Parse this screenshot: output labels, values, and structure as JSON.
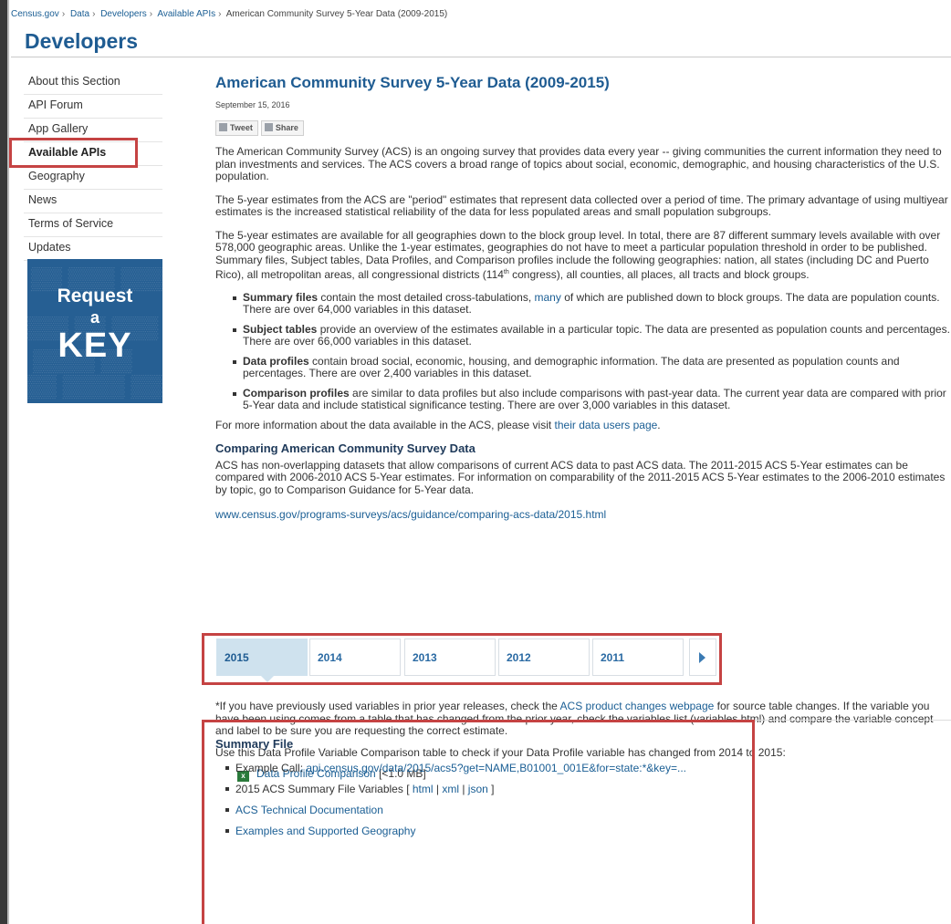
{
  "breadcrumb": [
    "Census.gov",
    "Data",
    "Developers",
    "Available APIs",
    "American Community Survey 5-Year Data (2009-2015)"
  ],
  "site_title": "Developers",
  "sidebar": {
    "items": [
      {
        "label": "About this Section"
      },
      {
        "label": "API Forum"
      },
      {
        "label": "App Gallery"
      },
      {
        "label": "Available APIs"
      },
      {
        "label": "Geography"
      },
      {
        "label": "News"
      },
      {
        "label": "Terms of Service"
      },
      {
        "label": "Updates"
      }
    ],
    "active_index": 3,
    "key_banner": {
      "line1": "Request",
      "line2": "a",
      "line3": "KEY"
    }
  },
  "main": {
    "title": "American Community Survey 5-Year Data (2009-2015)",
    "date": "September 15, 2016",
    "tweet_label": "Tweet",
    "share_label": "Share",
    "para1": "The American Community Survey (ACS) is an ongoing survey that provides data every year -- giving communities the current information they need to plan investments and services. The ACS covers a broad range of topics about social, economic, demographic, and housing characteristics of the U.S. population.",
    "para2": "The 5-year estimates from the ACS are \"period\" estimates that represent data collected over a period of time. The primary advantage of using multiyear estimates is the increased statistical reliability of the data for less populated areas and small population subgroups.",
    "para3_pre": "The 5-year estimates are available for all geographies down to the block group level.  In total, there are 87 different summary levels available with over 578,000 geographic areas.  Unlike the 1-year estimates, geographies do not have to meet a particular population threshold in order to be published.  Summary files, Subject tables, Data Profiles, and Comparison profiles include the following geographies: nation, all states (including DC and Puerto Rico), all metropolitan areas, all congressional districts (114",
    "para3_sup": "th",
    "para3_post": " congress), all counties, all places, all tracts and block groups.",
    "bullets": [
      {
        "bold": "Summary files",
        "pre": " contain the most detailed cross-tabulations, ",
        "link": "many",
        "post": " of which are published down to block groups. The data are population counts. There are over 64,000 variables in this dataset."
      },
      {
        "bold": "Subject tables",
        "pre": " provide an overview of the estimates available in a particular topic.  The data are presented as population counts and percentages.  There are over 66,000 variables in this dataset.",
        "link": "",
        "post": ""
      },
      {
        "bold": "Data profiles",
        "pre": " contain broad social, economic, housing, and demographic information. The data are presented as population counts and percentages. There are over 2,400 variables in this dataset.",
        "link": "",
        "post": ""
      },
      {
        "bold": "Comparison profiles",
        "pre": " are similar to data profiles but also include comparisons with past-year data.  The current year data are compared with prior 5-Year data and include statistical significance testing.  There are over 3,000 variables in this dataset.",
        "link": "",
        "post": ""
      }
    ],
    "more_pre": "For more information about the data available in the ACS, please visit ",
    "more_link": "their data users page",
    "more_post": ".",
    "compare_heading": "Comparing American Community Survey Data",
    "compare_para": "ACS has non-overlapping datasets that allow comparisons of current ACS data to past ACS data.  The 2011-2015 ACS 5-Year estimates can be compared with 2006-2010 ACS 5-Year estimates.  For information on comparability of the 2011-2015 ACS 5-Year estimates to the 2006-2010 estimates by topic, go to Comparison Guidance for 5-Year data.",
    "compare_url": "www.census.gov/programs-surveys/acs/guidance/comparing-acs-data/2015.html"
  },
  "year_tabs": {
    "years": [
      "2015",
      "2014",
      "2013",
      "2012",
      "2011"
    ],
    "selected": "2015"
  },
  "lower": {
    "para5_pre": "*If you have previously used variables in prior year releases, check the ",
    "para5_link": "ACS product changes webpage",
    "para5_post": " for source table changes. If the variable you have been using comes from a table that has changed from the prior year, check the variables list (variables.html) and compare the variable concept and label to be sure you are requesting the correct estimate.",
    "para6": "Use this Data Profile Variable Comparison table to check if your Data Profile variable has changed from 2014 to 2015:",
    "xls_icon": "x",
    "xls_link": "Data Profile Comparison",
    "xls_size": " [<1.0 MB]"
  },
  "summary_file": {
    "title": "Summary File",
    "example_label": "Example Call: ",
    "example_link": "api.census.gov/data/2015/acs5?get=NAME,B01001_001E&for=state:*&key=...",
    "vars_label": "2015 ACS Summary File Variables [ ",
    "vars_html": "html",
    "vars_sep1": " | ",
    "vars_xml": "xml",
    "vars_sep2": " | ",
    "vars_json": "json",
    "vars_end": " ]",
    "tech_doc": "ACS Technical Documentation",
    "examples": "Examples and Supported Geography"
  },
  "colors": {
    "brand": "#1f5c92",
    "link": "#1a5e94",
    "highlight": "#c54343",
    "tab_selected": "#cfe2ee"
  }
}
